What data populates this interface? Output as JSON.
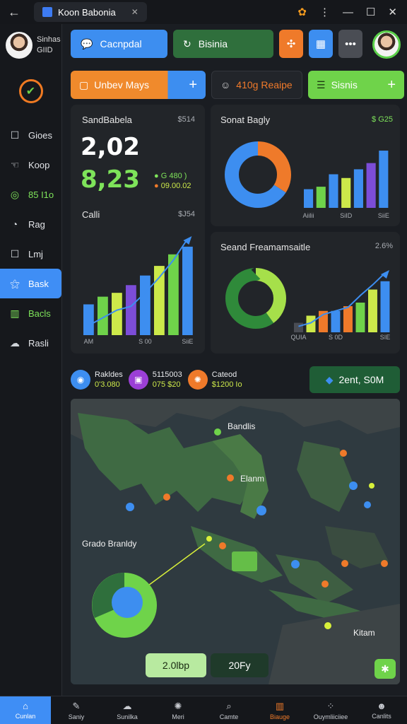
{
  "titlebar": {
    "back_icon": "arrow-left-icon",
    "tab_title": "Koon Babonia",
    "tab_close": "✕",
    "controls": [
      "settings-flower-icon",
      "more-icon",
      "minimize-icon",
      "maximize-icon",
      "close-icon"
    ]
  },
  "profile": {
    "name_line1": "Sinhas",
    "name_line2": "GIID"
  },
  "sidebar": {
    "items": [
      {
        "label": "Gioes",
        "icon": "square-icon"
      },
      {
        "label": "Koop",
        "icon": "hand-icon"
      },
      {
        "label": "85 I1o",
        "icon": "compass-icon",
        "color": "#7ee35a"
      },
      {
        "label": "Rag",
        "icon": "gauge-icon"
      },
      {
        "label": "Lmj",
        "icon": "square-icon"
      },
      {
        "label": "Bask",
        "icon": "satellite-icon",
        "active": true
      },
      {
        "label": "Bacls",
        "icon": "chart-icon",
        "color": "#7ee35a"
      },
      {
        "label": "Rasli",
        "icon": "cloud-icon"
      }
    ]
  },
  "topbar": {
    "btn1": "Cacnpdal",
    "btn2": "Bisinia"
  },
  "row2": {
    "orange_label": "Unbev Mays",
    "plus": "+",
    "recipe_label": "410g Reaipe",
    "lime_label": "Sisnis"
  },
  "card1": {
    "title": "SandBabela",
    "value": "$514",
    "big1": "2,02",
    "big2": "8,23",
    "legend1": "G 480 )",
    "legend2": "09.00.02",
    "sub_title": "Calli",
    "sub_value": "$J54"
  },
  "card2": {
    "title": "Sonat Bagly",
    "value": "$ G25",
    "xlabels": [
      "Aiilii",
      "SiID",
      "SiiE"
    ]
  },
  "card3": {
    "title": "Seand Freamamsaitle",
    "value": "2.6%",
    "xlabels": [
      "QUIA",
      "S 0D",
      "SIE"
    ]
  },
  "chart_data": [
    {
      "type": "bar",
      "title": "Calli",
      "categories": [
        "AM",
        "",
        "",
        "",
        "S 00",
        "",
        "",
        "SiiE"
      ],
      "values": [
        32,
        40,
        44,
        52,
        62,
        72,
        84,
        92
      ],
      "colors": [
        "#3d8ef0",
        "#6fd34a",
        "#cde94a",
        "#7c4dd8",
        "#3d8ef0",
        "#cde94a",
        "#6fd34a",
        "#3d8ef0"
      ],
      "trend": [
        10,
        18,
        26,
        30,
        44,
        60,
        78,
        100
      ],
      "ylim": [
        0,
        100
      ]
    },
    {
      "type": "pie",
      "title": "Sonat Bagly",
      "labels": [
        "orange",
        "blue"
      ],
      "values": [
        34,
        66
      ],
      "colors": [
        "#ef7a2a",
        "#3d8ef0"
      ]
    },
    {
      "type": "bar",
      "title": "Sonat Bagly",
      "categories": [
        "Aiilii",
        "",
        "",
        "SiID",
        "",
        "",
        "SiiE"
      ],
      "values": [
        30,
        34,
        54,
        48,
        62,
        72,
        92
      ],
      "colors": [
        "#3d8ef0",
        "#6fd34a",
        "#3d8ef0",
        "#cde94a",
        "#3d8ef0",
        "#7c4dd8",
        "#3d8ef0"
      ],
      "ylim": [
        0,
        100
      ]
    },
    {
      "type": "pie",
      "title": "Seand Freamamsaitle",
      "labels": [
        "lime",
        "green"
      ],
      "values": [
        40,
        60
      ],
      "colors": [
        "#a6e04a",
        "#2f8a3a"
      ]
    },
    {
      "type": "bar",
      "title": "Seand Freamamsaitle",
      "categories": [
        "QUIA",
        "",
        "",
        "S 0D",
        "",
        "",
        "",
        "SIE"
      ],
      "values": [
        16,
        28,
        36,
        36,
        44,
        50,
        72,
        86
      ],
      "colors": [
        "#4a4d54",
        "#cde94a",
        "#ef7a2a",
        "#3d8ef0",
        "#ef7a2a",
        "#6fd34a",
        "#cde94a",
        "#3d8ef0"
      ],
      "trend": [
        10,
        16,
        30,
        36,
        42,
        62,
        80,
        100
      ],
      "ylim": [
        0,
        100
      ]
    }
  ],
  "stats": [
    {
      "label": "Rakldes",
      "value": "0'3.080",
      "color": "#3d8ef0",
      "icon": "disc-icon"
    },
    {
      "label": "5115003",
      "value": "075 $20",
      "color": "#9b3fd6",
      "icon": "lock-icon"
    },
    {
      "label": "Cateod",
      "value": "$1200 Io",
      "color": "#ef7a2a",
      "icon": "gear-icon"
    }
  ],
  "stat_pill": "2ent, S0M",
  "map": {
    "labels": {
      "bandlis": "Bandlis",
      "elanm": "Elanm",
      "grado": "Grado Branldy",
      "kitam": "Kitam"
    },
    "btn_left": "2.0lbp",
    "btn_right": "20Fy",
    "btn_corner": "✱"
  },
  "bottomnav": [
    {
      "label": "Cunlan",
      "icon": "home-icon",
      "active": true
    },
    {
      "label": "Saniy",
      "icon": "edit-icon"
    },
    {
      "label": "Sunilka",
      "icon": "cloud-icon"
    },
    {
      "label": "Meri",
      "icon": "gear-icon"
    },
    {
      "label": "Camte",
      "icon": "search-icon"
    },
    {
      "label": "Biauge",
      "icon": "chart-icon",
      "orange": true
    },
    {
      "label": "Ouymliiciiee",
      "icon": "dots-icon"
    },
    {
      "label": "Canlits",
      "icon": "user-icon"
    }
  ]
}
